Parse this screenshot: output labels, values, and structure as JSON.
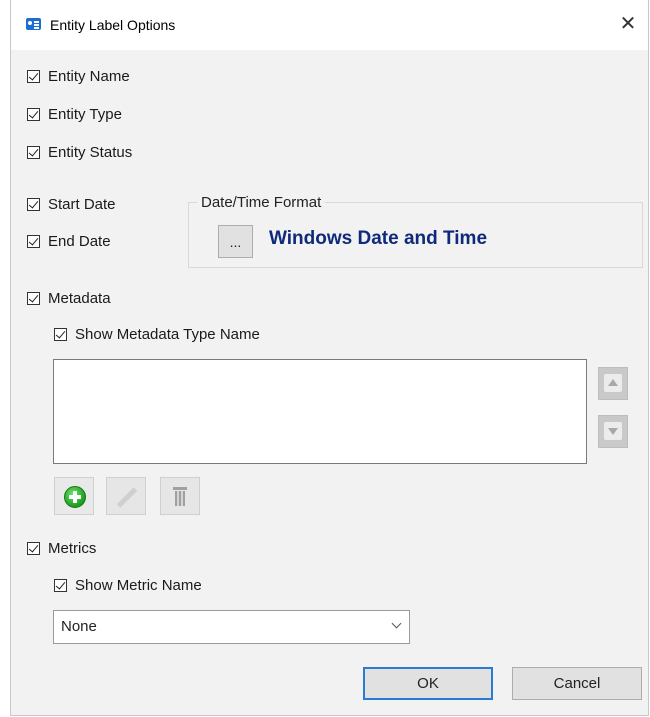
{
  "window": {
    "title": "Entity Label Options",
    "close_glyph": "✕",
    "title_icon": "id-card-icon"
  },
  "options": {
    "entity_name": {
      "label": "Entity Name",
      "checked": true
    },
    "entity_type": {
      "label": "Entity Type",
      "checked": true
    },
    "entity_status": {
      "label": "Entity Status",
      "checked": true
    },
    "start_date": {
      "label": "Start Date",
      "checked": true
    },
    "end_date": {
      "label": "End Date",
      "checked": true
    },
    "metadata": {
      "label": "Metadata",
      "checked": true
    },
    "show_metadata_type_name": {
      "label": "Show Metadata Type Name",
      "checked": true
    },
    "metrics": {
      "label": "Metrics",
      "checked": true
    },
    "show_metric_name": {
      "label": "Show Metric Name",
      "checked": true
    }
  },
  "date_time_format": {
    "group_label": "Date/Time Format",
    "browse_label": "...",
    "value": "Windows Date and Time",
    "value_color": "#0f2a7a"
  },
  "metadata_list": {
    "items": [],
    "move_up_icon": "arrow-up-icon",
    "move_down_icon": "arrow-down-icon",
    "add_icon": "plus-circle-icon",
    "edit_icon": "pencil-icon",
    "delete_icon": "trash-icon"
  },
  "metric_select": {
    "selected": "None"
  },
  "buttons": {
    "ok": "OK",
    "cancel": "Cancel"
  },
  "colors": {
    "accent": "#2a7bd4",
    "dialog_bg": "#f2f2f2"
  }
}
